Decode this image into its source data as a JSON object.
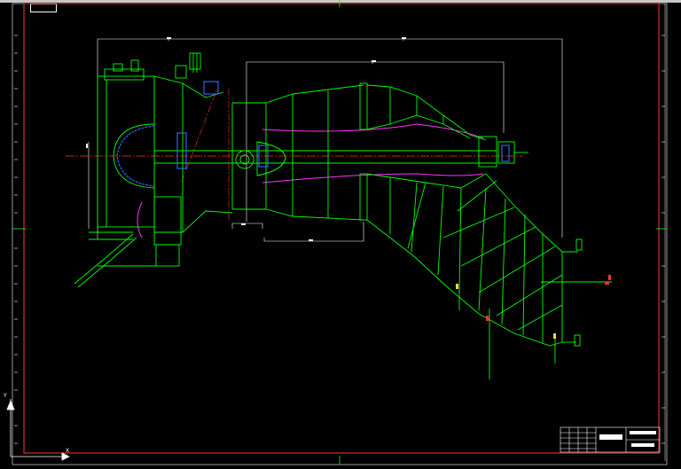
{
  "window": {
    "layout_tab": "",
    "title_block_title": "",
    "title_block_drawing_no": ""
  },
  "ucs": {
    "x_axis": "X",
    "y_axis": "Y"
  },
  "colors": {
    "background": "#000000",
    "frame": "#d43030",
    "geometry": "#00ff00",
    "dimension": "#ffffff",
    "hidden": "#ff33ff",
    "detail": "#3a6bff",
    "centerline": "#ff3030",
    "accent": "#ffd24a"
  },
  "tools": {
    "ucs_icon": "ucs-axis-icon",
    "crosshair": "crosshair-icon"
  }
}
